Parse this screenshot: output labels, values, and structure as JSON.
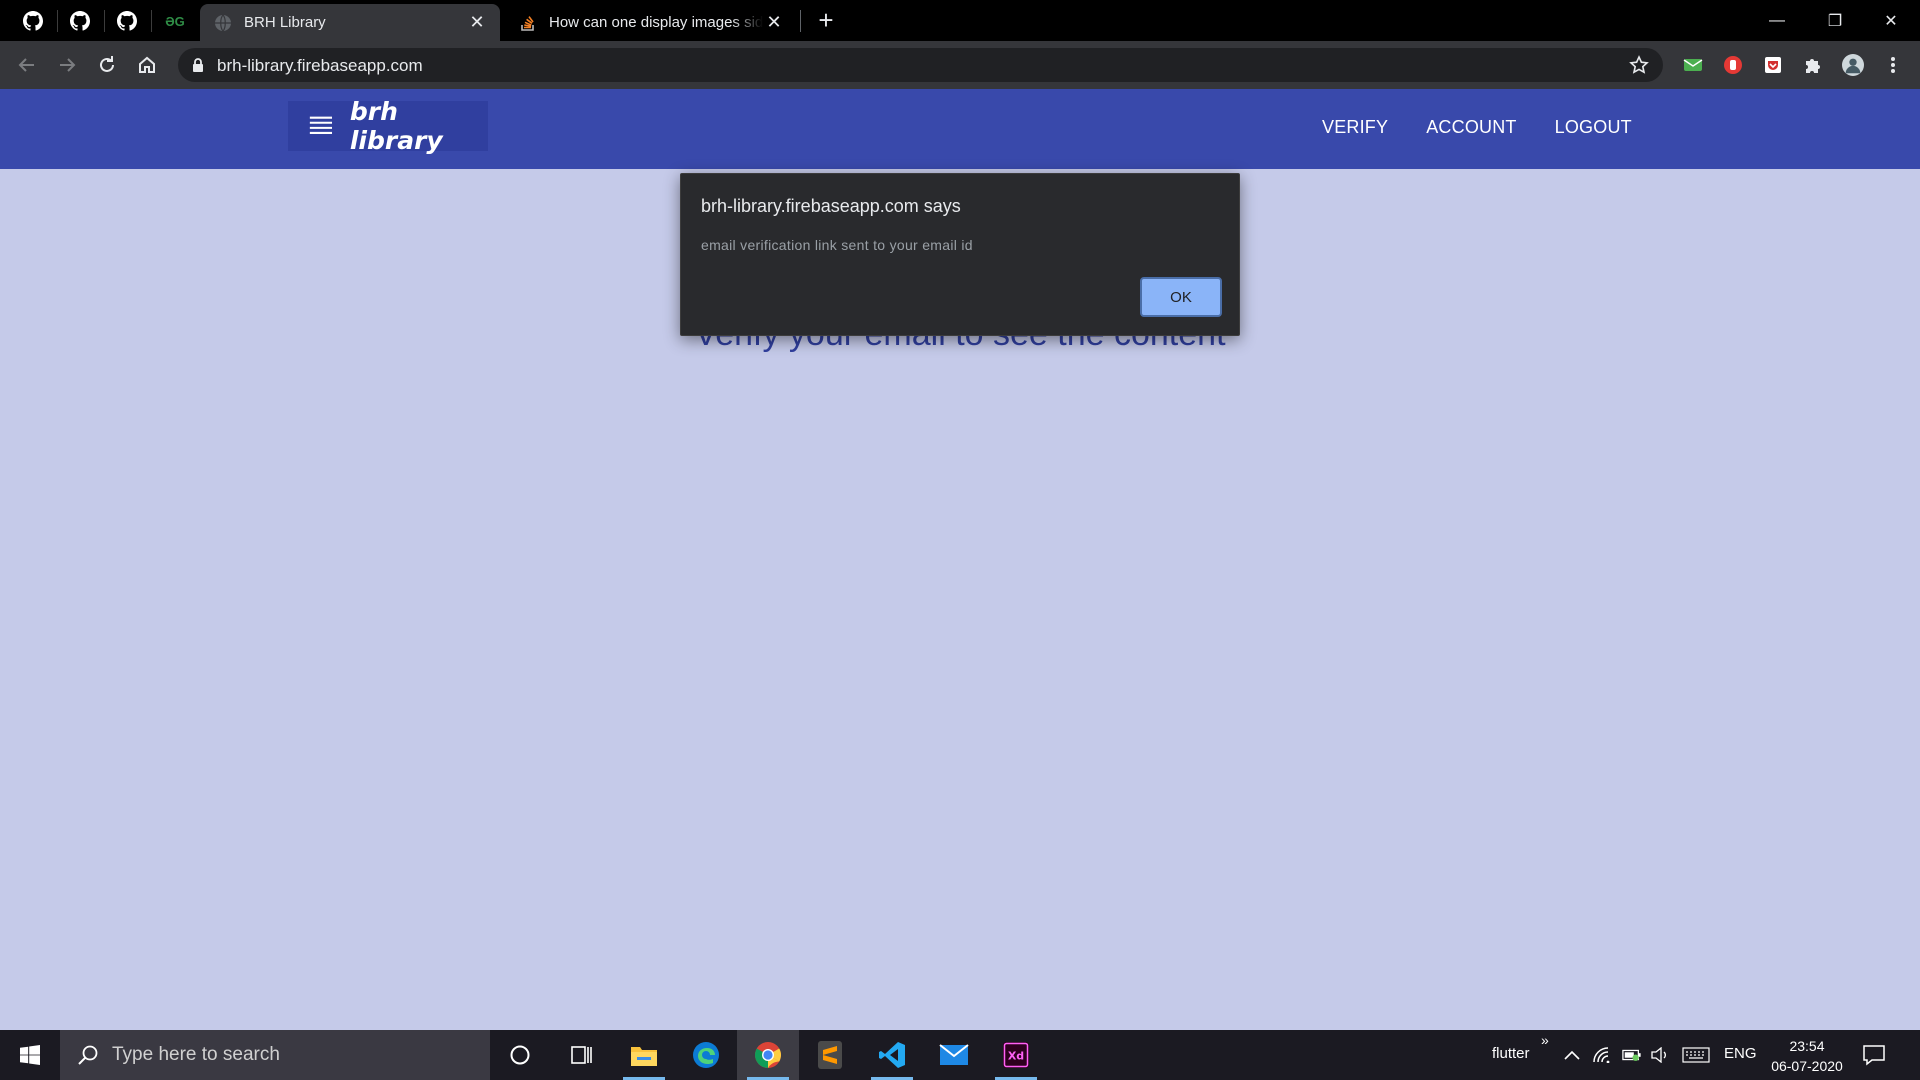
{
  "browser": {
    "tabs": [
      {
        "title": "BRH Library",
        "active": true
      },
      {
        "title": "How can one display images side",
        "active": false
      }
    ],
    "pinned_tabs": [
      "github-icon",
      "github-icon",
      "github-icon",
      "gfg-icon"
    ],
    "pinned_gfg_label": "ƏG",
    "url": "brh-library.firebaseapp.com",
    "window_controls": {
      "minimize": "—",
      "restore": "❐",
      "close": "✕"
    },
    "new_tab_label": "+"
  },
  "app": {
    "brand": "brh library",
    "nav": {
      "verify": "VERIFY",
      "account": "ACCOUNT",
      "logout": "LOGOUT"
    },
    "message": "Verify your email to see the content",
    "colors": {
      "appbar": "#3949ab",
      "brand_bg": "#303f9f",
      "page_bg": "#c5cae9",
      "heading": "#303f9f",
      "warning": "#ff9800"
    }
  },
  "dialog": {
    "title": "brh-library.firebaseapp.com says",
    "message": "email verification link sent to your email id",
    "ok_label": "OK"
  },
  "taskbar": {
    "search_placeholder": "Type here to search",
    "toolbar_label": "flutter",
    "chevron": "»",
    "language": "ENG",
    "time": "23:54",
    "date": "06-07-2020",
    "apps": [
      "cortana-icon",
      "task-view-icon",
      "file-explorer-icon",
      "edge-icon",
      "chrome-icon",
      "sublime-icon",
      "vscode-icon",
      "mail-icon",
      "adobe-xd-icon"
    ]
  }
}
